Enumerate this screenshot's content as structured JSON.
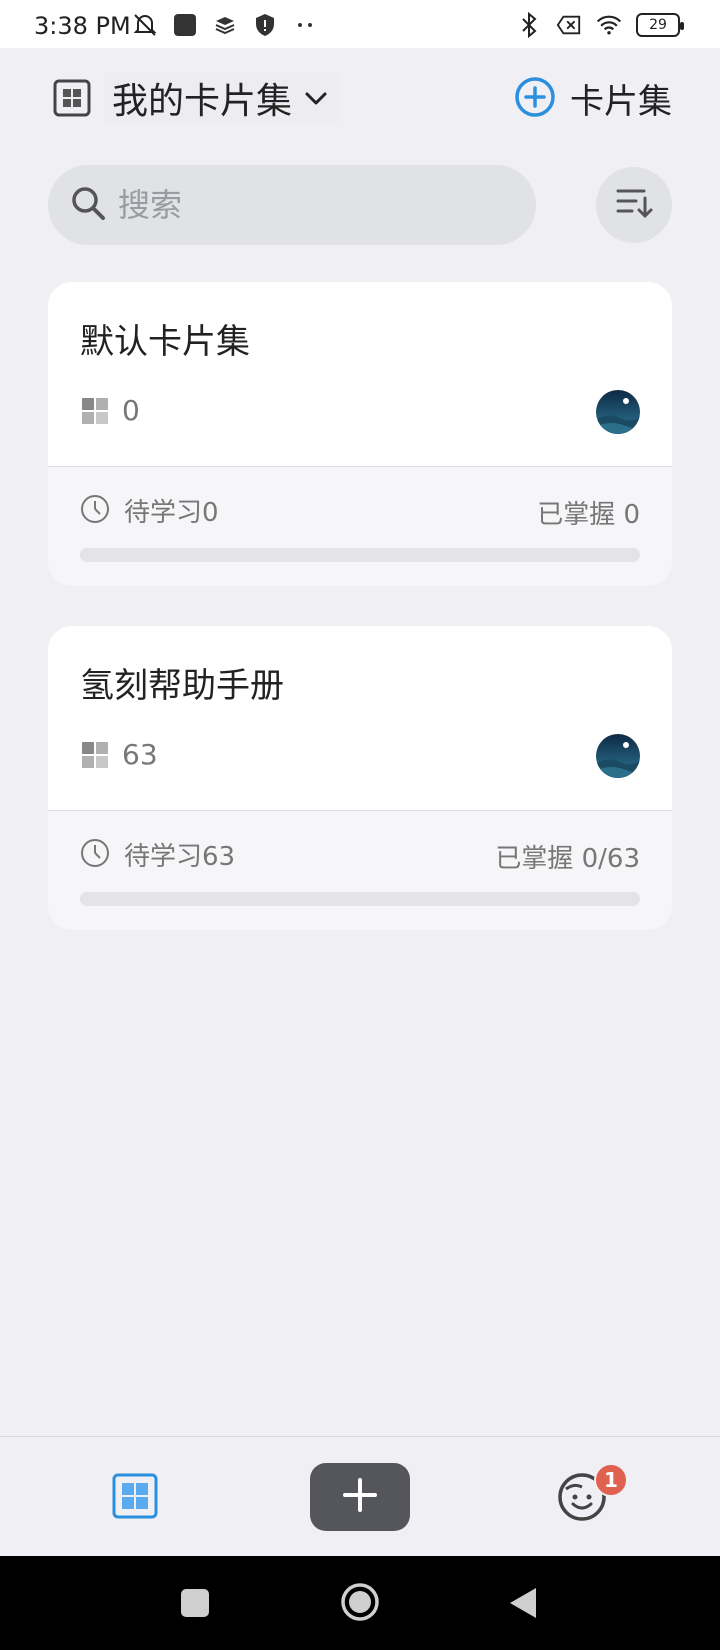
{
  "status_bar": {
    "time": "3:38 PM",
    "battery": "29"
  },
  "header": {
    "collection_title": "我的卡片集",
    "add_collection_label": "卡片集"
  },
  "search": {
    "placeholder": "搜索"
  },
  "cards": [
    {
      "title": "默认卡片集",
      "count": "0",
      "pending": "待学习0",
      "mastered": "已掌握 0",
      "progress": 0
    },
    {
      "title": "氢刻帮助手册",
      "count": "63",
      "pending": "待学习63",
      "mastered": "已掌握 0/63",
      "progress": 0
    }
  ],
  "bottom_nav": {
    "notification_badge": "1"
  },
  "colors": {
    "accent": "#2b8fe0",
    "badge": "#e06150",
    "page_bg": "#efeff4"
  }
}
